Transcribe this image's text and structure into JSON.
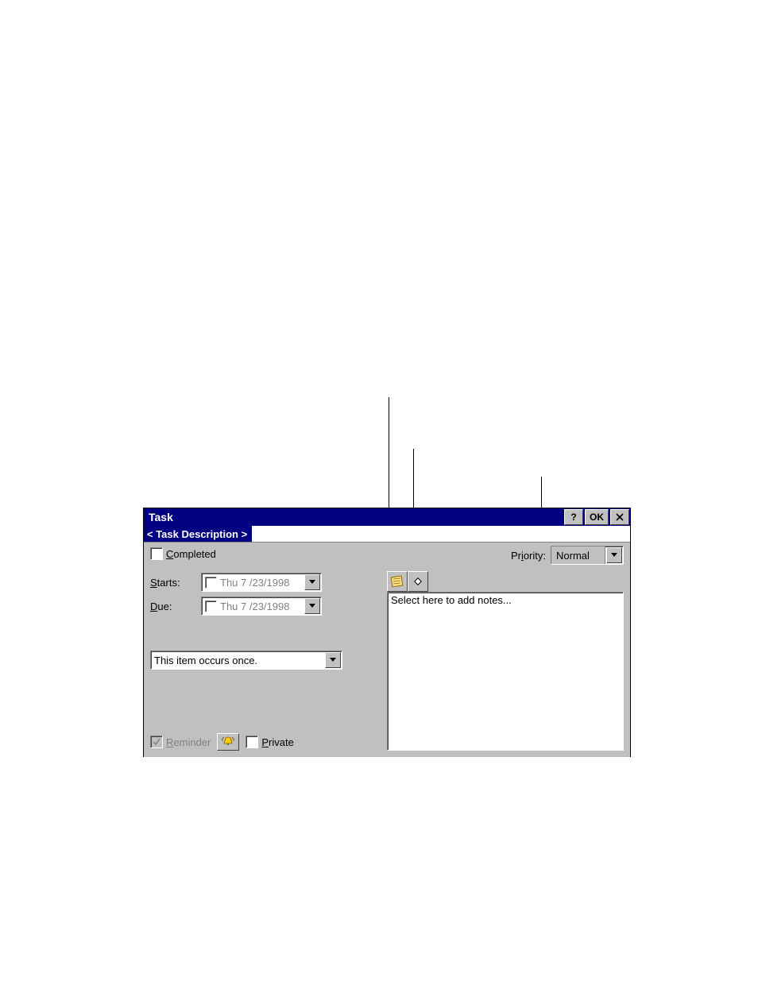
{
  "titlebar": {
    "title": "Task",
    "help": "?",
    "ok": "OK",
    "close": "✕"
  },
  "subject": {
    "label": "< Task Description >"
  },
  "completed": {
    "label_pre": "",
    "label_ul": "C",
    "label_post": "ompleted"
  },
  "priority": {
    "label_pre": "Pr",
    "label_ul": "i",
    "label_post": "ority:",
    "value": "Normal"
  },
  "starts": {
    "label_ul": "S",
    "label_post": "tarts:",
    "value": "Thu  7 /23/1998"
  },
  "due": {
    "label_ul": "D",
    "label_post": "ue:",
    "value": "Thu  7 /23/1998"
  },
  "recurrence": {
    "text": "This item occurs once."
  },
  "reminder": {
    "label_ul": "R",
    "label_post": "eminder"
  },
  "private": {
    "label_ul": "P",
    "label_post": "rivate"
  },
  "notes_placeholder": "Select here to add notes...",
  "icons": {
    "notes": "notes-icon",
    "voice": "voice-icon",
    "bell": "bell-icon"
  }
}
